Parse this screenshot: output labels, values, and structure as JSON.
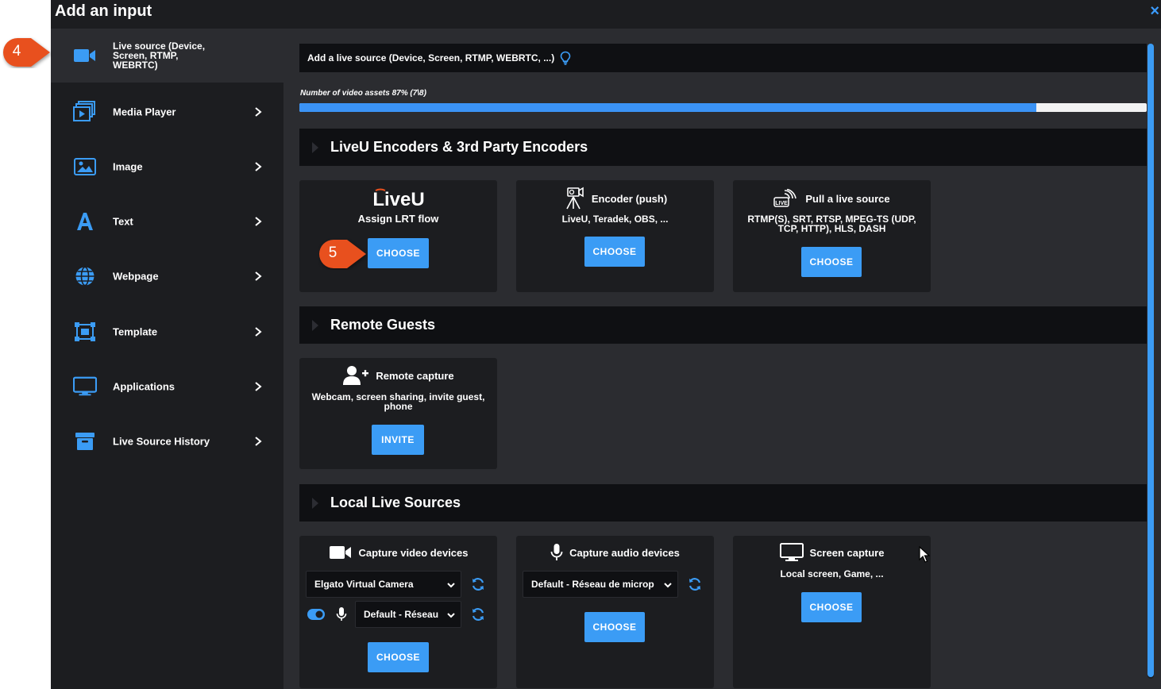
{
  "modal": {
    "title": "Add an input",
    "close_label": "×"
  },
  "sidebar": {
    "items": [
      {
        "label": "Live source (Device, Screen, RTMP, WEBRTC)",
        "icon": "video-camera-icon"
      },
      {
        "label": "Media Player",
        "icon": "media-player-icon"
      },
      {
        "label": "Image",
        "icon": "image-icon"
      },
      {
        "label": "Text",
        "icon": "text-icon"
      },
      {
        "label": "Webpage",
        "icon": "globe-icon"
      },
      {
        "label": "Template",
        "icon": "template-icon"
      },
      {
        "label": "Applications",
        "icon": "monitor-icon"
      },
      {
        "label": "Live Source History",
        "icon": "archive-icon"
      }
    ]
  },
  "main": {
    "info_text": "Add a live source (Device, Screen, RTMP, WEBRTC, ...)",
    "assets_label": "Number of video assets 87% (7\\8)",
    "assets_progress": 0.87,
    "sections": {
      "encoders": {
        "title": "LiveU Encoders & 3rd Party Encoders",
        "cards": {
          "liveu": {
            "logo": "LiveU",
            "subtitle": "Assign LRT flow",
            "button": "CHOOSE"
          },
          "push": {
            "title": "Encoder (push)",
            "subtitle": "LiveU, Teradek, OBS, ...",
            "button": "CHOOSE"
          },
          "pull": {
            "title": "Pull a live source",
            "subtitle": "RTMP(S), SRT, RTSP, MPEG-TS (UDP, TCP, HTTP), HLS, DASH",
            "button": "CHOOSE"
          }
        }
      },
      "guests": {
        "title": "Remote Guests",
        "cards": {
          "remote": {
            "title": "Remote capture",
            "subtitle": "Webcam, screen sharing, invite guest, phone",
            "button": "INVITE"
          }
        }
      },
      "local": {
        "title": "Local Live Sources",
        "cards": {
          "video": {
            "title": "Capture video devices",
            "camera_select": "Elgato Virtual Camera",
            "audio_select": "Default - Réseau",
            "button": "CHOOSE"
          },
          "audio": {
            "title": "Capture audio devices",
            "audio_select": "Default - Réseau de microp",
            "button": "CHOOSE"
          },
          "screen": {
            "title": "Screen capture",
            "subtitle": "Local screen, Game, ...",
            "button": "CHOOSE"
          }
        }
      }
    }
  },
  "callouts": {
    "step4": "4",
    "step5": "5"
  },
  "colors": {
    "accent": "#3b9cf5",
    "callout": "#e8501e",
    "panel": "#1c1d20",
    "background": "#2b2c30",
    "bar": "#0f1013"
  }
}
